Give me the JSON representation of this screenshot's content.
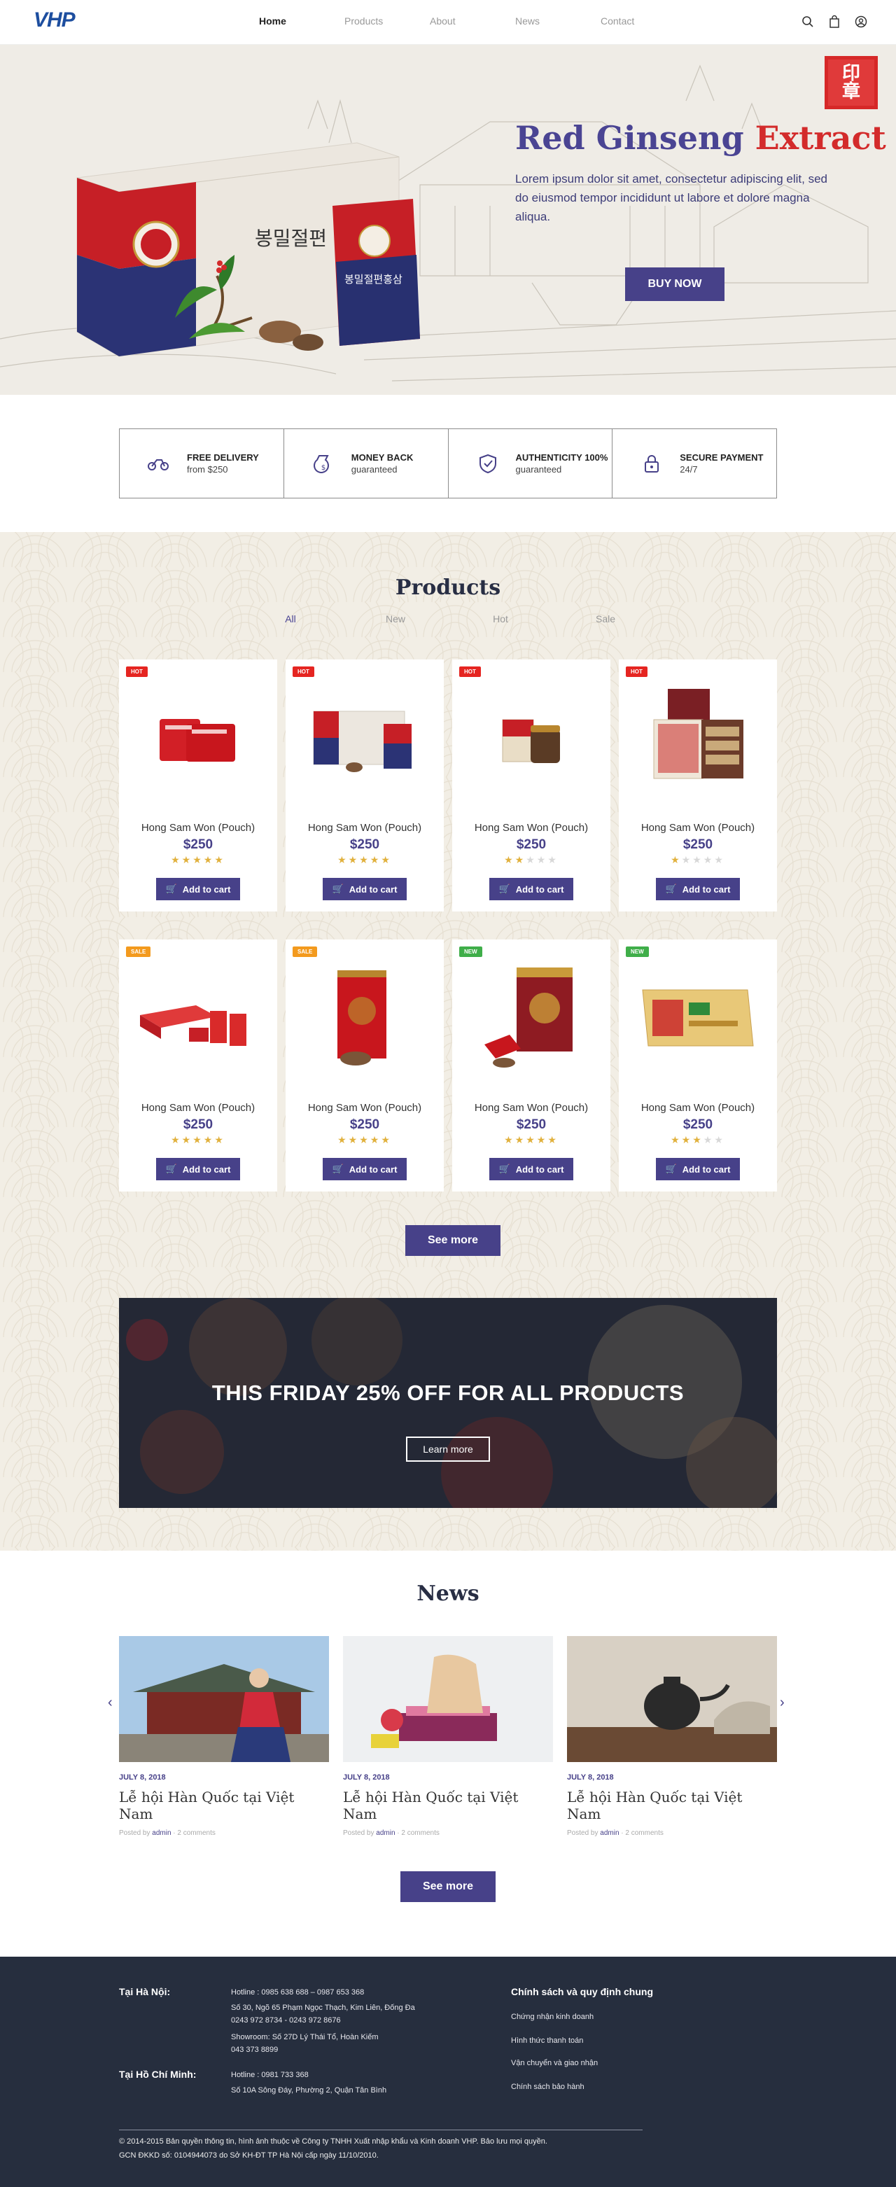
{
  "header": {
    "logo": "VHP",
    "nav": [
      "Home",
      "Products",
      "About",
      "News",
      "Contact"
    ]
  },
  "hero": {
    "title_part1": "Red Ginseng",
    "title_part2": "Extract",
    "description": "Lorem ipsum dolor sit amet, consectetur adipiscing elit, sed do eiusmod tempor incididunt ut labore et dolore magna aliqua.",
    "button": "BUY NOW",
    "box_text": "봉밀절편",
    "pouch_text": "봉밀절편홍삼"
  },
  "features": [
    {
      "icon": "delivery-icon",
      "title": "FREE DELIVERY",
      "sub": "from $250"
    },
    {
      "icon": "money-bag-icon",
      "title": "MONEY BACK",
      "sub": "guaranteed"
    },
    {
      "icon": "shield-check-icon",
      "title": "AUTHENTICITY 100%",
      "sub": "guaranteed"
    },
    {
      "icon": "lock-icon",
      "title": "SECURE PAYMENT",
      "sub": "24/7"
    }
  ],
  "products": {
    "title": "Products",
    "tabs": [
      "All",
      "New",
      "Hot",
      "Sale"
    ],
    "add_to_cart": "Add to cart",
    "items": [
      {
        "badge": "HOT",
        "name": "Hong Sam Won (Pouch)",
        "price": "$250",
        "rating": 5
      },
      {
        "badge": "HOT",
        "name": "Hong Sam Won (Pouch)",
        "price": "$250",
        "rating": 5
      },
      {
        "badge": "HOT",
        "name": "Hong Sam Won (Pouch)",
        "price": "$250",
        "rating": 2
      },
      {
        "badge": "HOT",
        "name": "Hong Sam Won (Pouch)",
        "price": "$250",
        "rating": 1
      },
      {
        "badge": "SALE",
        "name": "Hong Sam Won (Pouch)",
        "price": "$250",
        "rating": 5
      },
      {
        "badge": "SALE",
        "name": "Hong Sam Won (Pouch)",
        "price": "$250",
        "rating": 5
      },
      {
        "badge": "NEW",
        "name": "Hong Sam Won (Pouch)",
        "price": "$250",
        "rating": 5
      },
      {
        "badge": "NEW",
        "name": "Hong Sam Won (Pouch)",
        "price": "$250",
        "rating": 3
      }
    ],
    "see_more": "See more"
  },
  "colors": {
    "hot": "#e52521",
    "sale": "#f39a1e",
    "new": "#3fae49",
    "accent": "#474189"
  },
  "promo": {
    "title": "THIS FRIDAY 25% OFF FOR ALL PRODUCTS",
    "button": "Learn more"
  },
  "news": {
    "title": "News",
    "items": [
      {
        "date": "JULY 8, 2018",
        "title": "Lễ hội Hàn Quốc tại Việt Nam",
        "posted_by": "Posted by",
        "author": "admin",
        "comments": "2 comments"
      },
      {
        "date": "JULY 8, 2018",
        "title": "Lễ hội Hàn Quốc tại Việt Nam",
        "posted_by": "Posted by",
        "author": "admin",
        "comments": "2 comments"
      },
      {
        "date": "JULY 8, 2018",
        "title": "Lễ hội Hàn Quốc tại Việt Nam",
        "posted_by": "Posted by",
        "author": "admin",
        "comments": "2 comments"
      }
    ],
    "see_more": "See more"
  },
  "footer": {
    "hanoi_label": "Tại Hà Nội:",
    "hanoi_hotline": "Hotline : 0985 638 688 – 0987 653 368",
    "hanoi_address1": "Số 30, Ngõ 65 Phạm Ngọc Thạch, Kim Liên, Đống Đa",
    "hanoi_phone1": "0243 972 8734 - 0243 972 8676",
    "hanoi_showroom": "Showroom: Số 27D Lý Thái Tổ, Hoàn Kiếm",
    "hanoi_phone2": "043 373 8899",
    "hcm_label": "Tại Hồ Chí Minh:",
    "hcm_hotline": "Hotline : 0981 733 368",
    "hcm_address": "Số 10A Sông Đáy, Phường 2, Quận Tân Bình",
    "policy_title": "Chính sách và quy định chung",
    "policy_links": [
      "Chứng nhận kinh doanh",
      "Hình thức thanh toán",
      "Vận chuyển và giao nhận",
      "Chính sách bảo hành"
    ],
    "copyright": "© 2014-2015 Bản quyền thông tin, hình ảnh thuộc về Công ty TNHH Xuất nhập khẩu và Kinh doanh VHP. Bảo lưu mọi quyền.",
    "license": "GCN ĐKKD số: 0104944073 do Sở KH-ĐT TP Hà Nội cấp ngày 11/10/2010."
  }
}
